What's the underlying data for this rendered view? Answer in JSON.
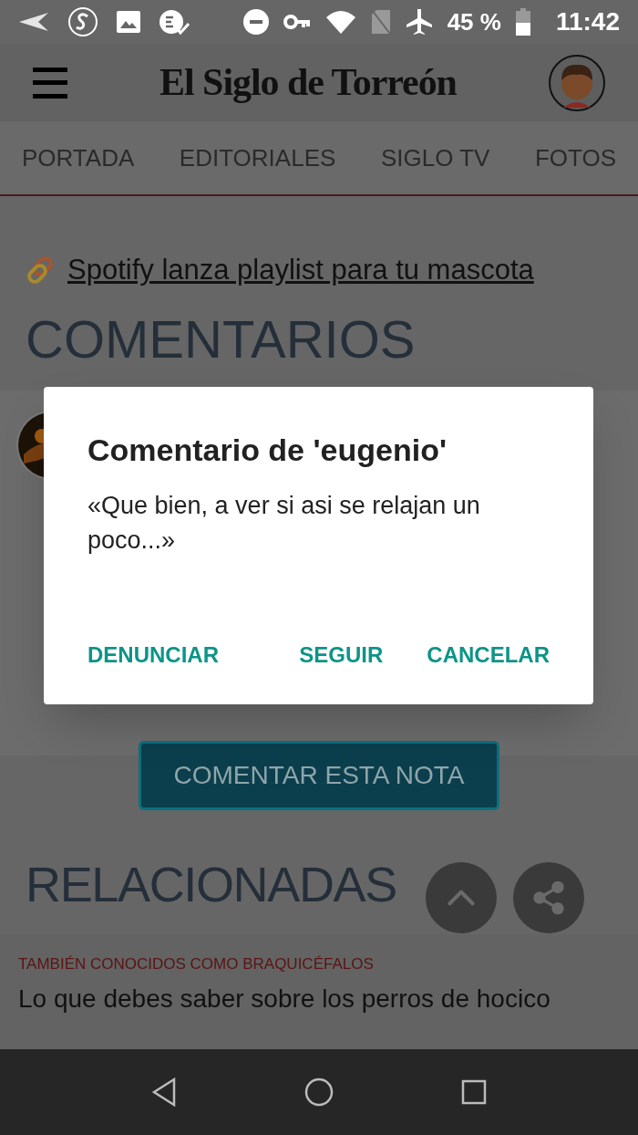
{
  "status_bar": {
    "battery": "45 %",
    "time": "11:42"
  },
  "header": {
    "logo": "El Siglo de Torreón"
  },
  "tabs": [
    {
      "label": "PORTADA",
      "selected": false
    },
    {
      "label": "EDITORIALES",
      "selected": false
    },
    {
      "label": "SIGLO TV",
      "selected": false
    },
    {
      "label": "FOTOS",
      "selected": false
    }
  ],
  "article": {
    "link": "Spotify lanza playlist para tu mascota",
    "comments_heading": "COMENTARIOS",
    "comment_button": "COMENTAR ESTA NOTA",
    "related_heading": "RELACIONADAS",
    "related": {
      "kicker": "TAMBIÉN CONOCIDOS COMO BRAQUICÉFALOS",
      "title": "Lo que debes saber sobre los perros de hocico"
    }
  },
  "dialog": {
    "title": "Comentario de 'eugenio'",
    "message": "«Que bien, a ver si asi se relajan un poco...»",
    "actions": [
      "DENUNCIAR",
      "SEGUIR",
      "CANCELAR"
    ]
  }
}
